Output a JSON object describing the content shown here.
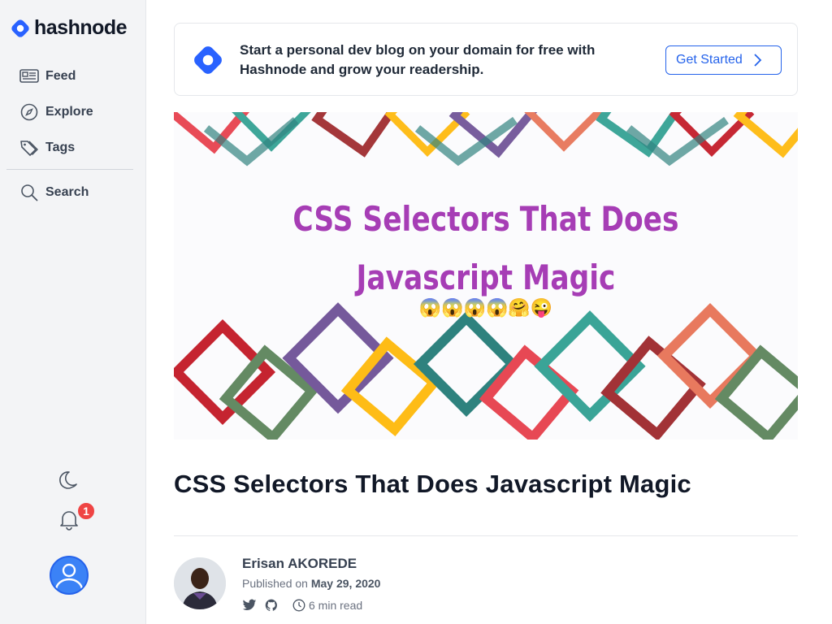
{
  "brand": {
    "name": "hashnode",
    "accent": "#2962ff"
  },
  "nav": [
    {
      "label": "Feed",
      "icon": "feed-icon"
    },
    {
      "label": "Explore",
      "icon": "compass-icon"
    },
    {
      "label": "Tags",
      "icon": "tag-icon"
    }
  ],
  "search": {
    "label": "Search",
    "icon": "search-icon"
  },
  "notifications": {
    "count": "1"
  },
  "banner": {
    "text": "Start a personal dev blog on your domain for free with Hashnode and grow your readership.",
    "cta": "Get Started"
  },
  "cover": {
    "title": "CSS Selectors That Does Javascript Magic",
    "emoji": "😱😱😱😱🤗😜"
  },
  "article": {
    "title": "CSS Selectors That Does Javascript Magic",
    "author": "Erisan AKOREDE",
    "published_prefix": "Published on",
    "published_date": "May 29, 2020",
    "read_time": "6 min read"
  },
  "colors": {
    "cover_title": "#a63db5",
    "badge": "#ef4444",
    "cta_border": "#2563eb"
  }
}
